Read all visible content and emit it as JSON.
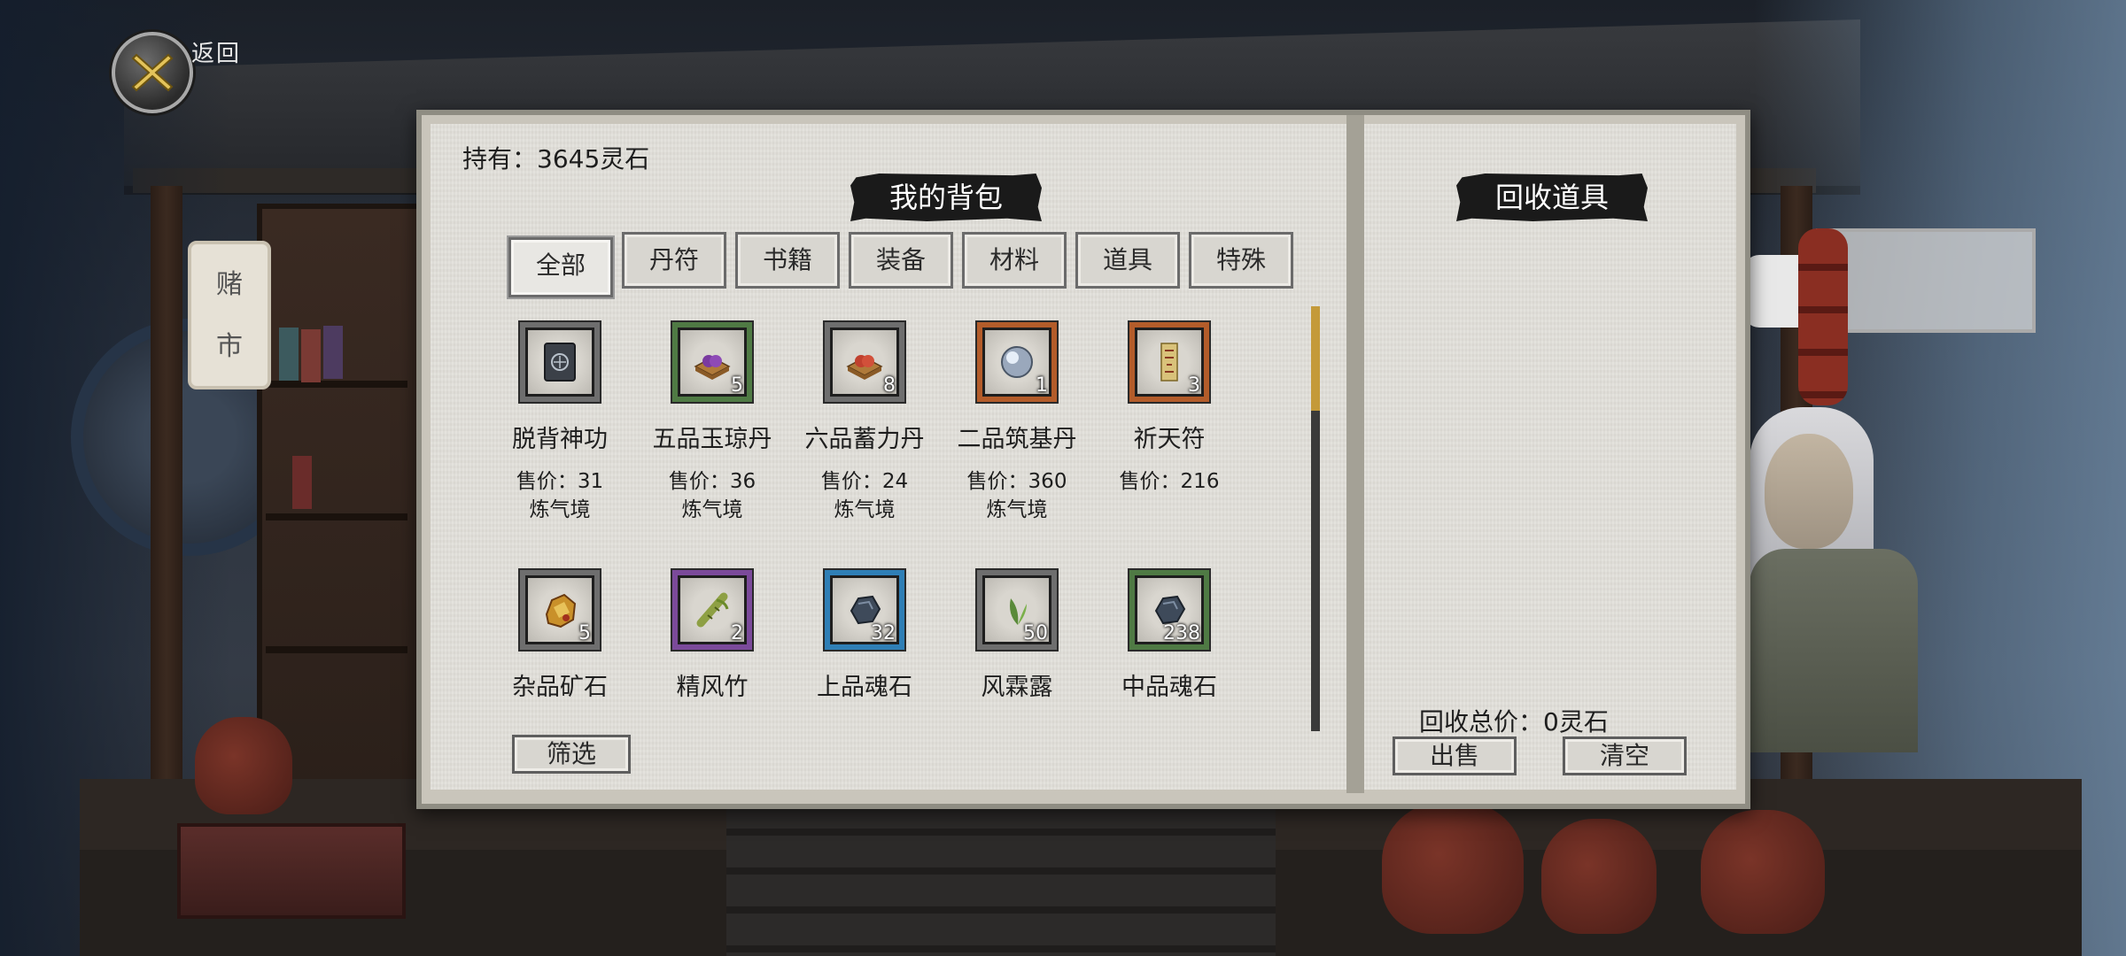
{
  "header": {
    "back_label": "返回"
  },
  "wallet": {
    "holding_text": "持有：3645灵石"
  },
  "bag": {
    "title": "我的背包",
    "tabs": [
      {
        "label": "全部",
        "active": true
      },
      {
        "label": "丹符",
        "active": false
      },
      {
        "label": "书籍",
        "active": false
      },
      {
        "label": "装备",
        "active": false
      },
      {
        "label": "材料",
        "active": false
      },
      {
        "label": "道具",
        "active": false
      },
      {
        "label": "特殊",
        "active": false
      }
    ],
    "items": [
      {
        "name": "脱背神功",
        "count": "",
        "price": "售价：31",
        "realm": "炼气境",
        "icon": "book-icon",
        "rarity": "gray"
      },
      {
        "name": "五品玉琼丹",
        "count": "5",
        "price": "售价：36",
        "realm": "炼气境",
        "icon": "pill-box-icon",
        "rarity": "green"
      },
      {
        "name": "六品蓄力丹",
        "count": "8",
        "price": "售价：24",
        "realm": "炼气境",
        "icon": "pill-box-icon",
        "rarity": "gray"
      },
      {
        "name": "二品筑基丹",
        "count": "1",
        "price": "售价：360",
        "realm": "炼气境",
        "icon": "orb-icon",
        "rarity": "orange"
      },
      {
        "name": "祈天符",
        "count": "3",
        "price": "售价：216",
        "realm": "",
        "icon": "talisman-icon",
        "rarity": "orange"
      },
      {
        "name": "杂品矿石",
        "count": "5",
        "price": "",
        "realm": "",
        "icon": "ore-icon",
        "rarity": "gray"
      },
      {
        "name": "精风竹",
        "count": "2",
        "price": "",
        "realm": "",
        "icon": "bamboo-icon",
        "rarity": "purple"
      },
      {
        "name": "上品魂石",
        "count": "32",
        "price": "",
        "realm": "",
        "icon": "soul-stone-icon",
        "rarity": "blue"
      },
      {
        "name": "风霖露",
        "count": "50",
        "price": "",
        "realm": "",
        "icon": "herb-leaf-icon",
        "rarity": "gray"
      },
      {
        "name": "中品魂石",
        "count": "238",
        "price": "",
        "realm": "",
        "icon": "soul-stone-icon",
        "rarity": "green"
      }
    ],
    "filter_label": "筛选"
  },
  "recycle": {
    "title": "回收道具",
    "total_text": "回收总价：0灵石",
    "sell_label": "出售",
    "clear_label": "清空"
  },
  "colors": {
    "accent_gold": "#c49a3a",
    "panel_paper": "#e2e0da"
  }
}
